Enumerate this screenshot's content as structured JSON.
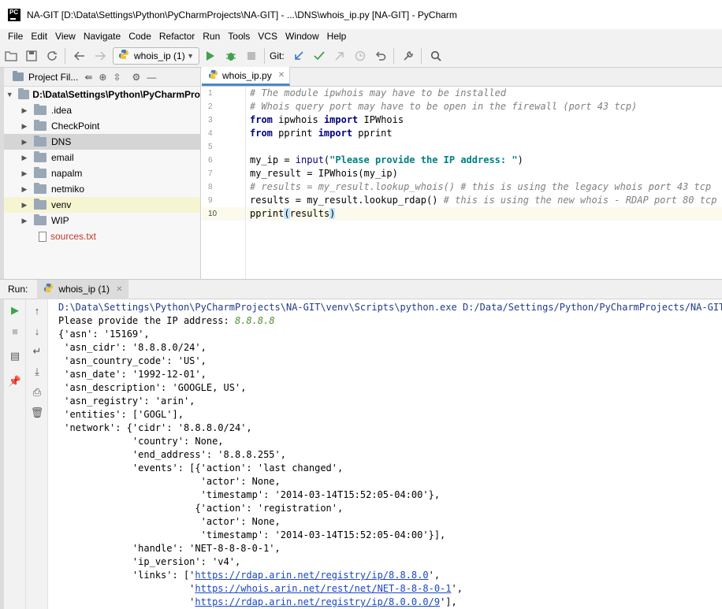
{
  "window": {
    "title": "NA-GIT [D:\\Data\\Settings\\Python\\PyCharmProjects\\NA-GIT] - ...\\DNS\\whois_ip.py [NA-GIT] - PyCharm",
    "logo_text": "PC"
  },
  "menu": [
    "File",
    "Edit",
    "View",
    "Navigate",
    "Code",
    "Refactor",
    "Run",
    "Tools",
    "VCS",
    "Window",
    "Help"
  ],
  "toolbar": {
    "run_config": "whois_ip (1)",
    "git_label": "Git:"
  },
  "project": {
    "title": "Project Fil...",
    "root": "D:\\Data\\Settings\\Python\\PyCharmPro",
    "items": [
      {
        "label": ".idea",
        "type": "folder"
      },
      {
        "label": "CheckPoint",
        "type": "folder"
      },
      {
        "label": "DNS",
        "type": "folder"
      },
      {
        "label": "email",
        "type": "folder"
      },
      {
        "label": "napalm",
        "type": "folder"
      },
      {
        "label": "netmiko",
        "type": "folder"
      },
      {
        "label": "venv",
        "type": "folder"
      },
      {
        "label": "WIP",
        "type": "folder"
      },
      {
        "label": "sources.txt",
        "type": "file"
      }
    ]
  },
  "editor": {
    "tab": "whois_ip.py",
    "line_numbers": [
      "1",
      "2",
      "3",
      "4",
      "5",
      "6",
      "7",
      "8",
      "9",
      "10"
    ],
    "code": {
      "l1": "# The module ipwhois may have to be installed",
      "l2": "# Whois query port may have to be open in the firewall (port 43 tcp)",
      "l3_kw1": "from",
      "l3_mod": " ipwhois ",
      "l3_kw2": "import",
      "l3_name": " IPWhois",
      "l4_kw1": "from",
      "l4_mod": " pprint ",
      "l4_kw2": "import",
      "l4_name": " pprint",
      "l6_a": "my_ip = ",
      "l6_fn": "input",
      "l6_b": "(",
      "l6_str": "\"Please provide the IP address: \"",
      "l6_c": ")",
      "l7": "my_result = IPWhois(my_ip)",
      "l8": "# results = my_result.lookup_whois() # this is using the legacy whois port 43 tcp",
      "l9_a": "results = my_result.lookup_rdap() ",
      "l9_cm": "# this is using the new whois - RDAP port 80 tcp",
      "l10_a": "pprint",
      "l10_b": "(",
      "l10_c": "results",
      "l10_d": ")"
    }
  },
  "run": {
    "label": "Run:",
    "tab": "whois_ip (1)",
    "cmd": "D:\\Data\\Settings\\Python\\PyCharmProjects\\NA-GIT\\venv\\Scripts\\python.exe D:/Data/Settings/Python/PyCharmProjects/NA-GIT/DNS",
    "prompt": "Please provide the IP address: ",
    "prompt_input": "8.8.8.8",
    "output": [
      "{'asn': '15169',",
      " 'asn_cidr': '8.8.8.0/24',",
      " 'asn_country_code': 'US',",
      " 'asn_date': '1992-12-01',",
      " 'asn_description': 'GOOGLE, US',",
      " 'asn_registry': 'arin',",
      " 'entities': ['GOGL'],",
      " 'network': {'cidr': '8.8.8.0/24',",
      "             'country': None,",
      "             'end_address': '8.8.8.255',",
      "             'events': [{'action': 'last changed',",
      "                         'actor': None,",
      "                         'timestamp': '2014-03-14T15:52:05-04:00'},",
      "                        {'action': 'registration',",
      "                         'actor': None,",
      "                         'timestamp': '2014-03-14T15:52:05-04:00'}],",
      "             'handle': 'NET-8-8-8-0-1',",
      "             'ip_version': 'v4',"
    ],
    "links_prefix1": "             'links': ['",
    "link1": "https://rdap.arin.net/registry/ip/8.8.8.0",
    "links_suffix1": "',",
    "links_prefix2": "                       '",
    "link2": "https://whois.arin.net/rest/net/NET-8-8-8-0-1",
    "links_suffix2": "',",
    "links_prefix3": "                       '",
    "link3": "https://rdap.arin.net/registry/ip/8.0.0.0/9",
    "links_suffix3": "'],"
  }
}
